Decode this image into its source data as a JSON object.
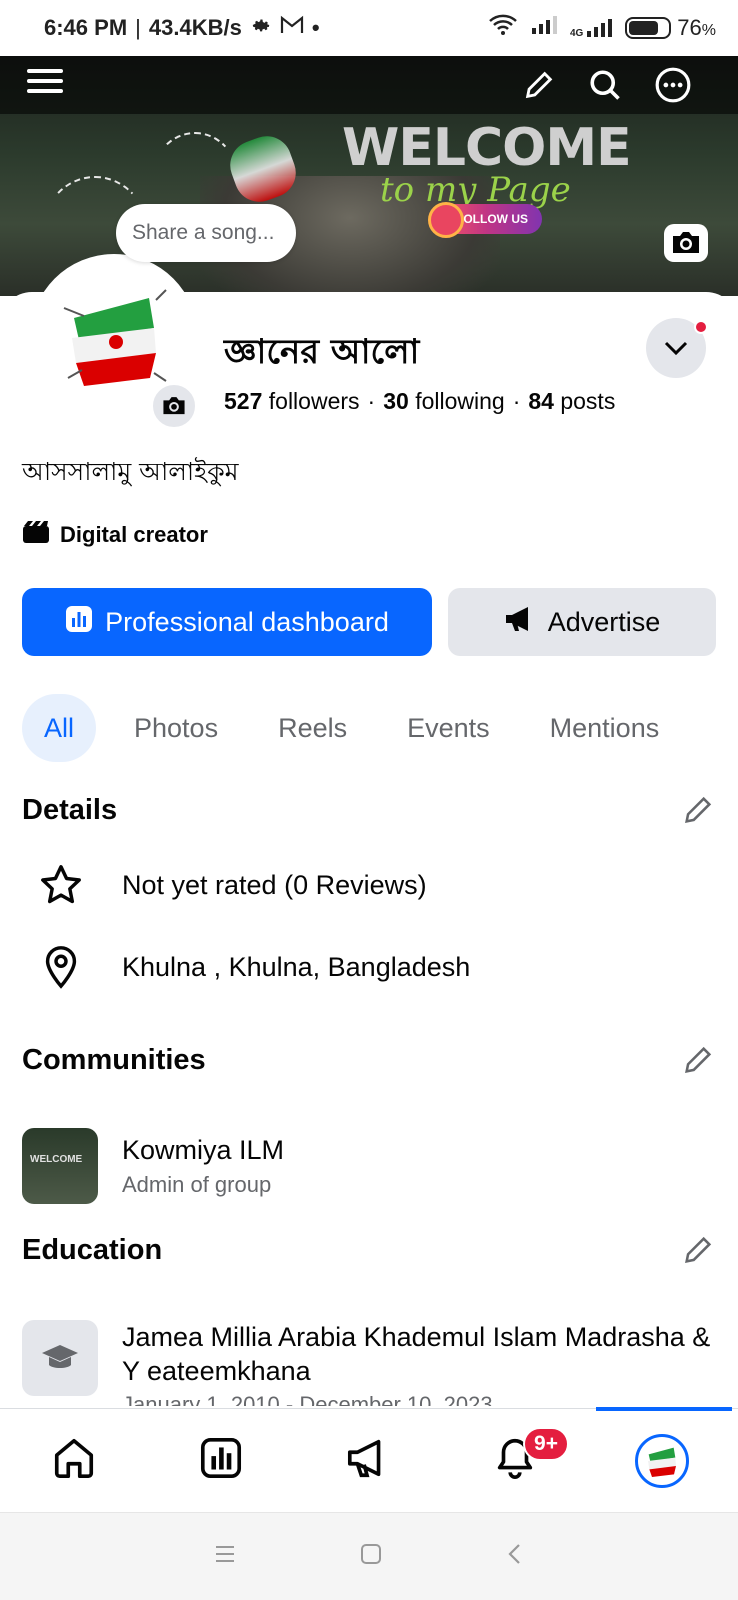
{
  "status_bar": {
    "time": "6:46 PM",
    "speed": "43.4KB/s",
    "network": "4G",
    "battery": "76",
    "battery_unit": "%"
  },
  "cover": {
    "welcome_text": "WELCOME",
    "subtitle_text": "to my Page",
    "follow_text": "FOLLOW US",
    "share_song_placeholder": "Share a song..."
  },
  "profile": {
    "name": "জ্ঞানের আলো",
    "followers_count": "527",
    "followers_label": "followers",
    "following_count": "30",
    "following_label": "following",
    "posts_count": "84",
    "posts_label": "posts",
    "bio": "আসসালামু আলাইকুম",
    "category": "Digital creator"
  },
  "buttons": {
    "primary": "Professional dashboard",
    "secondary": "Advertise"
  },
  "tabs": [
    "All",
    "Photos",
    "Reels",
    "Events",
    "Mentions"
  ],
  "details": {
    "title": "Details",
    "rating": "Not yet rated (0 Reviews)",
    "location": "Khulna , Khulna, Bangladesh"
  },
  "communities": {
    "title": "Communities",
    "items": [
      {
        "name": "Kowmiya ILM",
        "role": "Admin of group",
        "thumb_text": "WELCOME"
      }
    ]
  },
  "education": {
    "title": "Education",
    "items": [
      {
        "name": "Jamea Millia Arabia Khademul Islam Madrasha & Y eateemkhana",
        "dates": "January 1, 2010 - December 10, 2023"
      }
    ]
  },
  "bottom_nav": {
    "notification_badge": "9+"
  },
  "colors": {
    "accent": "#0866ff",
    "badge_red": "#e41e3f",
    "secondary_bg": "#e4e6eb",
    "muted_text": "#65676b"
  }
}
